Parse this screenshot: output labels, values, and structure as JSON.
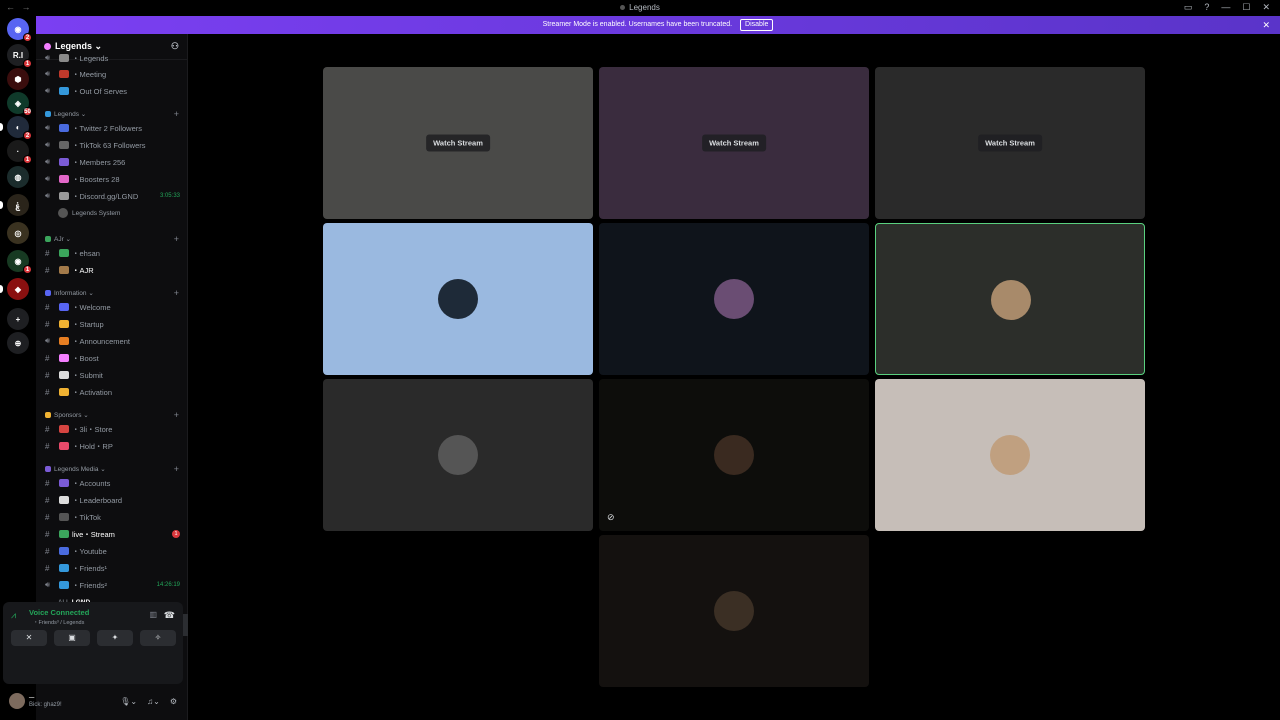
{
  "window": {
    "title": "Legends",
    "nav": "← →"
  },
  "banner": {
    "text": "Streamer Mode is enabled. Usernames have been truncated.",
    "disable": "Disable",
    "close": "✕"
  },
  "rail": {
    "servers": [
      {
        "label": "◉",
        "color": "#5865f2",
        "badge": "2"
      },
      {
        "label": "R.I",
        "color": "#1e1f22",
        "badge": "1"
      },
      {
        "label": "⬢",
        "color": "#3a0d0d",
        "badge": ""
      },
      {
        "label": "◈",
        "color": "#0f3a2a",
        "badge": "50"
      },
      {
        "label": "◐",
        "color": "#202a3a",
        "badge": "2"
      },
      {
        "label": "·",
        "color": "#1a1a1a",
        "badge": "1"
      },
      {
        "label": "◍",
        "color": "#1b2c2c",
        "badge": ""
      },
      {
        "label": "ۼ",
        "color": "#2a241a",
        "badge": ""
      },
      {
        "label": "◎",
        "color": "#3a3220",
        "badge": ""
      },
      {
        "label": "◉",
        "color": "#173a22",
        "badge": "1"
      },
      {
        "label": "◆",
        "color": "#8a1010",
        "badge": ""
      },
      {
        "label": "+",
        "color": "#1e1f22",
        "badge": ""
      },
      {
        "label": "⊕",
        "color": "#1e1f22",
        "badge": ""
      }
    ]
  },
  "sidebar": {
    "guild_name": "Legends ⌄",
    "channels_top": [
      {
        "label": "・Legends",
        "emoji_color": "#8a8a8a"
      },
      {
        "label": "・Meeting",
        "emoji_color": "#c0392b"
      },
      {
        "label": "・Out Of Serves",
        "emoji_color": "#3498db"
      }
    ],
    "cat_legends": "Legends ⌄",
    "legends_channels": [
      {
        "label": "・Twitter 2 Followers",
        "emoji_color": "#4a6bdf"
      },
      {
        "label": "・TikTok 63 Followers",
        "emoji_color": "#666"
      },
      {
        "label": "・Members 256",
        "emoji_color": "#7b5bd6"
      },
      {
        "label": "・Boosters 28",
        "emoji_color": "#e267c8"
      },
      {
        "label": "・Discord.gg/LGND",
        "emoji_color": "#9a9a9a",
        "time": "3:05:33"
      }
    ],
    "legends_system": "Legends System",
    "cat_ajr": "AJr ⌄",
    "ajr_channels": [
      {
        "label": "・ehsan",
        "emoji_color": "#3ba55c"
      },
      {
        "label": "・AJR",
        "emoji_color": "#a37a4a"
      }
    ],
    "cat_info": "Information ⌄",
    "info_channels": [
      {
        "label": "・Welcome",
        "emoji_color": "#5865f2"
      },
      {
        "label": "・Startup",
        "emoji_color": "#f0b232"
      },
      {
        "label": "・Announcement",
        "emoji_color": "#e67e22"
      },
      {
        "label": "・Boost",
        "emoji_color": "#f47fff"
      },
      {
        "label": "・Submit",
        "emoji_color": "#dddddd"
      },
      {
        "label": "・Activation",
        "emoji_color": "#f0b232"
      }
    ],
    "cat_sponsors": "Sponsors ⌄",
    "sponsor_channels": [
      {
        "label": "・3li・Store",
        "emoji_color": "#d64541"
      },
      {
        "label": "・Hold・RP",
        "emoji_color": "#e84a6a"
      }
    ],
    "cat_media": "Legends Media ⌄",
    "media_channels": [
      {
        "label": "・Accounts",
        "emoji_color": "#7b5bd6"
      },
      {
        "label": "・Leaderboard",
        "emoji_color": "#dddddd"
      },
      {
        "label": "・TikTok",
        "emoji_color": "#555"
      },
      {
        "label": "live・Stream",
        "emoji_color": "#3ba55c",
        "unread": "1"
      },
      {
        "label": "・Youtube",
        "emoji_color": "#4a6bdf"
      },
      {
        "label": "・Friends¹",
        "emoji_color": "#3498db"
      },
      {
        "label": "・Friends²",
        "emoji_color": "#3498db",
        "time": "14:26:19"
      }
    ],
    "ali_user": "ALI",
    "ali_tag": "LGND",
    "friends3": {
      "label": "・Friends³",
      "time": "42:24",
      "status": "Set a channel status ✎"
    }
  },
  "voice_panel": {
    "status": "Voice Connected",
    "channel": "・Friends³ / Legends",
    "buttons": [
      "✕",
      "▣",
      "✦",
      "✧"
    ]
  },
  "user": {
    "name": "ـــ",
    "status": "Bick: ghaz9!"
  },
  "stage": {
    "tiles": [
      {
        "kind": "stream",
        "bg": "#4a4a48",
        "watch": "Watch Stream"
      },
      {
        "kind": "stream",
        "bg": "#3a2c3e",
        "watch": "Watch Stream"
      },
      {
        "kind": "stream",
        "bg": "#2a2a2a",
        "watch": "Watch Stream"
      },
      {
        "kind": "user",
        "bg": "#9ab9e0",
        "av": "#1e2a38"
      },
      {
        "kind": "user",
        "bg": "#0f141b",
        "av": "#6a4d73"
      },
      {
        "kind": "user",
        "bg": "#2c2e2a",
        "av": "#a88a6a",
        "speaking": true
      },
      {
        "kind": "user",
        "bg": "#2a2a2a",
        "av": "#555"
      },
      {
        "kind": "user",
        "bg": "#0d0d0b",
        "av": "#3a2a20",
        "muted": true
      },
      {
        "kind": "user",
        "bg": "#c6beb8",
        "av": "#c0a080"
      },
      {
        "kind": "user",
        "bg": "#14110f",
        "av": "#3b2f24"
      }
    ]
  }
}
